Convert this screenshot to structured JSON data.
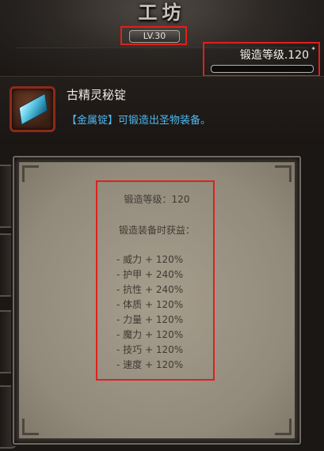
{
  "header": {
    "title": "工坊",
    "level_label": "LV.30"
  },
  "forge": {
    "label": "锻造等级.120",
    "progress": 0.0
  },
  "item": {
    "name": "古精灵秘锭",
    "description": "【金属锭】可锻造出圣物装备。",
    "icon": "silver-ingot-icon"
  },
  "stats": {
    "forge_level": "锻造等级：120",
    "bonus_title": "锻造装备时获益：",
    "bonuses": [
      "- 威力 + 120%",
      "- 护甲 + 240%",
      "- 抗性 + 240%",
      "- 体质 + 120%",
      "- 力量 + 120%",
      "- 魔力 + 120%",
      "- 技巧 + 120%",
      "- 速度 + 120%"
    ]
  },
  "colors": {
    "highlight": "#e0201c",
    "item_desc": "#4fb8ee",
    "parchment": "#a69d8d"
  }
}
